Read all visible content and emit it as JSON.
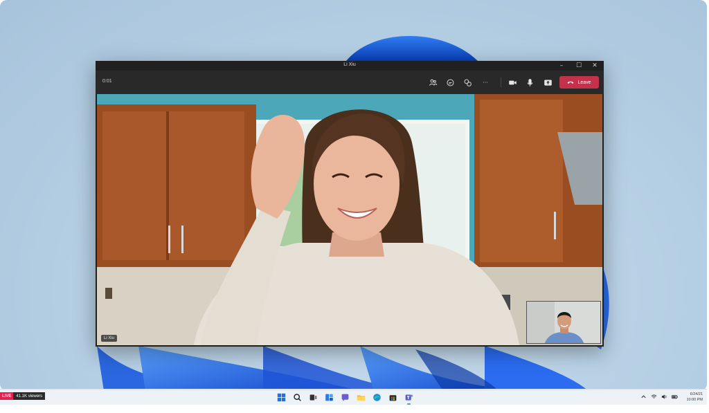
{
  "window": {
    "title": "Li Xiu",
    "controls": {
      "minimize": "–",
      "maximize": "☐",
      "close": "✕"
    }
  },
  "call": {
    "timer": "0:01",
    "toolbar_icons": [
      "people-icon",
      "chat-icon",
      "reactions-icon",
      "more-icon",
      "camera-icon",
      "mic-icon",
      "share-icon"
    ],
    "more_label": "···",
    "leave_label": "Leave",
    "leave_color": "#c4314b"
  },
  "video": {
    "participant_name": "Li Xiu"
  },
  "stream": {
    "live_label": "LIVE",
    "viewers": "41.1K viewers"
  },
  "taskbar": {
    "apps": [
      "start-icon",
      "search-icon",
      "task-view-icon",
      "widgets-icon",
      "chat-icon",
      "file-explorer-icon",
      "edge-icon",
      "store-icon",
      "teams-icon"
    ],
    "clock_date": "6/24/21",
    "clock_time": "10:00 PM",
    "tray": [
      "chevron-up-icon",
      "wifi-icon",
      "volume-icon",
      "battery-icon"
    ]
  },
  "colors": {
    "accent_blue": "#1a5fe0",
    "window_bg": "#1f1f1f",
    "live_red": "#e0234e"
  }
}
